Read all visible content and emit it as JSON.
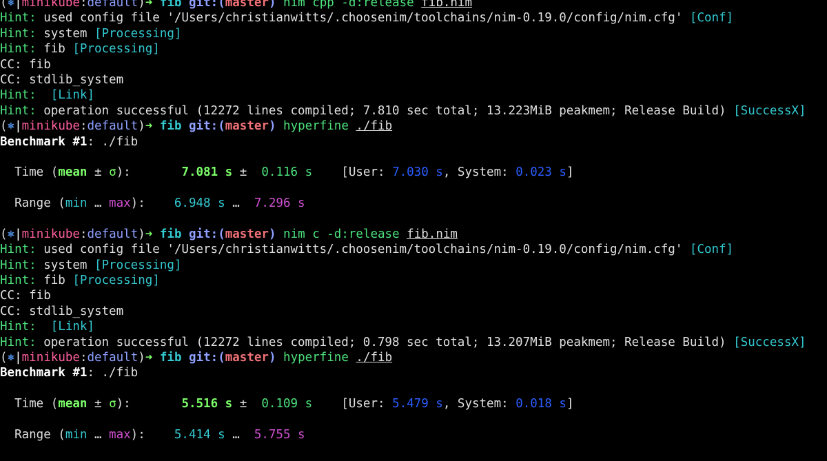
{
  "colors": {
    "background": "#000000",
    "hint": "#4de27c",
    "bracket_tag": "#33c9d1",
    "prompt_user": "#ff5f9e",
    "prompt_branch": "#f07178",
    "mean_value": "#7dff6a",
    "user_sys_values": "#2a5dff",
    "range_max": "#d050d0"
  },
  "icons": {
    "kube_icon": "kubernetes-wheel-icon",
    "prompt_arrow": "arrow-right-icon"
  },
  "prompt": {
    "open_paren": "(",
    "kube_glyph": "⎈",
    "separator": "|",
    "context": "minikube",
    "colon": ":",
    "namespace": "default",
    "close_paren": ")",
    "arrow": "➜",
    "dir": "fib",
    "git_label": "git:(",
    "branch": "master",
    "git_close": ")"
  },
  "runs": [
    {
      "command": "nim cpp -d:release",
      "command_file": "fib.nim",
      "hints": {
        "config_prefix": "Hint:",
        "config_text": " used config file '/Users/christianwitts/.choosenim/toolchains/nim-0.19.0/config/nim.cfg' ",
        "config_tag": "[Conf]",
        "system_prefix": "Hint:",
        "system_text": " system ",
        "system_tag": "[Processing]",
        "fib_prefix": "Hint:",
        "fib_text": " fib ",
        "fib_tag": "[Processing]",
        "link_prefix": "Hint:",
        "link_text": "  ",
        "link_tag": "[Link]",
        "success_prefix": "Hint:",
        "success_text": " operation successful (12272 lines compiled; 7.810 sec total; 13.223MiB peakmem; Release Build) ",
        "success_tag": "[SuccessX]"
      },
      "cc_lines": [
        "CC: fib",
        "CC: stdlib_system"
      ],
      "bench_command": "hyperfine",
      "bench_target": "./fib",
      "benchmark": {
        "label": "Benchmark #1",
        "target": ": ./fib",
        "time_label": "  Time (",
        "mean_label": "mean",
        "pm": " ± ",
        "sigma": "σ",
        "time_close": "):",
        "mean": "7.081 s",
        "pm2": "±",
        "sigma_value": "0.116 s",
        "user_label": "[User: ",
        "user": "7.030 s",
        "system_label": ", System: ",
        "system": "0.023 s",
        "bracket_close": "]",
        "range_label": "  Range (",
        "min_label": "min",
        "ellipsis": " … ",
        "max_label": "max",
        "range_close": "):",
        "min": "6.948 s",
        "ellipsis2": "…",
        "max": "7.296 s"
      }
    },
    {
      "command": "nim c -d:release",
      "command_file": "fib.nim",
      "hints": {
        "config_prefix": "Hint:",
        "config_text": " used config file '/Users/christianwitts/.choosenim/toolchains/nim-0.19.0/config/nim.cfg' ",
        "config_tag": "[Conf]",
        "system_prefix": "Hint:",
        "system_text": " system ",
        "system_tag": "[Processing]",
        "fib_prefix": "Hint:",
        "fib_text": " fib ",
        "fib_tag": "[Processing]",
        "link_prefix": "Hint:",
        "link_text": "  ",
        "link_tag": "[Link]",
        "success_prefix": "Hint:",
        "success_text": " operation successful (12272 lines compiled; 0.798 sec total; 13.207MiB peakmem; Release Build) ",
        "success_tag": "[SuccessX]"
      },
      "cc_lines": [
        "CC: fib",
        "CC: stdlib_system"
      ],
      "bench_command": "hyperfine",
      "bench_target": "./fib",
      "benchmark": {
        "label": "Benchmark #1",
        "target": ": ./fib",
        "time_label": "  Time (",
        "mean_label": "mean",
        "pm": " ± ",
        "sigma": "σ",
        "time_close": "):",
        "mean": "5.516 s",
        "pm2": "±",
        "sigma_value": "0.109 s",
        "user_label": "[User: ",
        "user": "5.479 s",
        "system_label": ", System: ",
        "system": "0.018 s",
        "bracket_close": "]",
        "range_label": "  Range (",
        "min_label": "min",
        "ellipsis": " … ",
        "max_label": "max",
        "range_close": "):",
        "min": "5.414 s",
        "ellipsis2": "…",
        "max": "5.755 s"
      }
    }
  ]
}
